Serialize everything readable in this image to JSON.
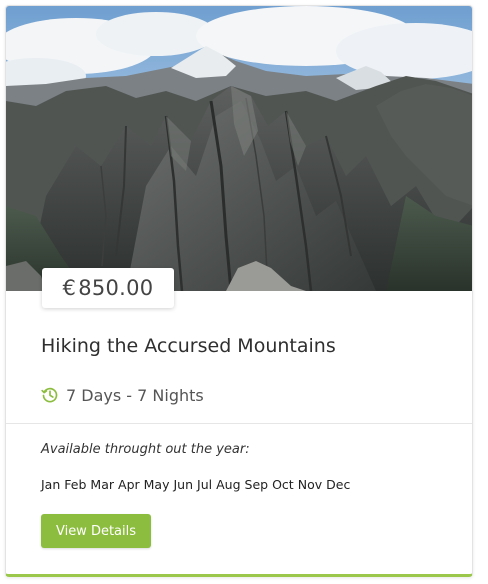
{
  "colors": {
    "accent": "#8cbd3f",
    "card_border_bottom": "#9bc84a",
    "clock_icon": "#8cbd3f"
  },
  "image": {
    "subject": "mountain landscape photo",
    "icon": "photo"
  },
  "tour": {
    "currency": "€",
    "price": "850.00",
    "title": "Hiking the Accursed Mountains",
    "duration_icon": "clock-history-icon",
    "duration": "7 Days - 7 Nights",
    "availability_label": "Available throught out the year:",
    "months": [
      "Jan",
      "Feb",
      "Mar",
      "Apr",
      "May",
      "Jun",
      "Jul",
      "Aug",
      "Sep",
      "Oct",
      "Nov",
      "Dec"
    ],
    "button_label": "View Details"
  }
}
